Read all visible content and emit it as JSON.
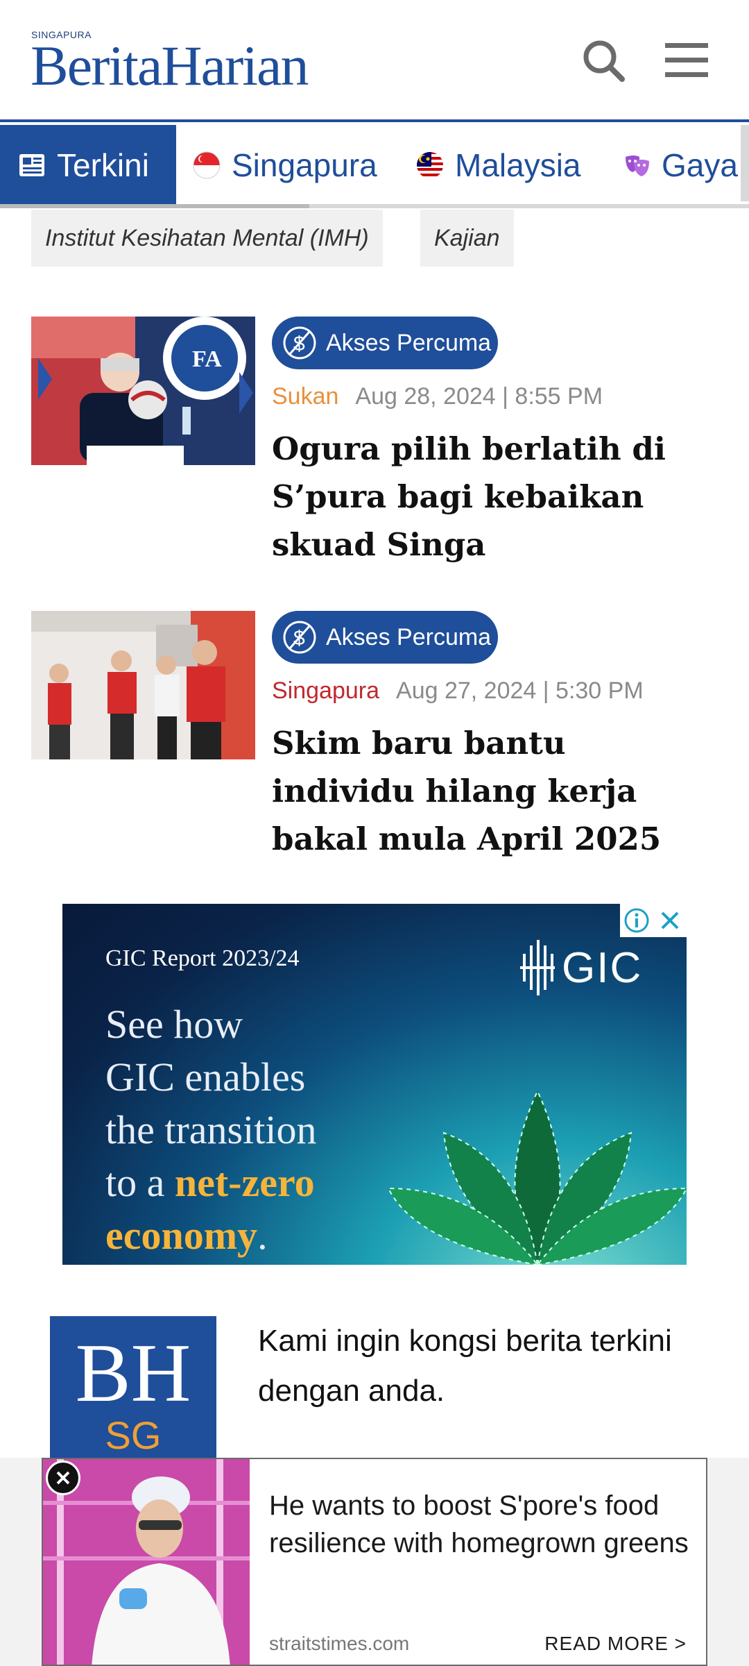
{
  "header": {
    "logo_small": "SINGAPURA",
    "logo_main": "BeritaHarian",
    "search_icon": "search-icon",
    "menu_icon": "hamburger-menu-icon"
  },
  "nav": {
    "tabs": [
      {
        "label": "Terkini",
        "icon": "newspaper-icon",
        "active": true
      },
      {
        "label": "Singapura",
        "icon": "singapore-flag-icon",
        "active": false
      },
      {
        "label": "Malaysia",
        "icon": "malaysia-flag-icon",
        "active": false
      },
      {
        "label": "Gaya",
        "icon": "theatre-masks-icon",
        "active": false
      }
    ]
  },
  "tags": [
    "Institut Kesihatan Mental (IMH)",
    "Kajian"
  ],
  "articles": [
    {
      "badge": "Akses Percuma",
      "category": "Sukan",
      "category_color": "#e8913a",
      "date": "Aug 28, 2024 | 8:55 PM",
      "headline": "Ogura pilih berlatih di S’pura bagi kebaikan skuad Singa"
    },
    {
      "badge": "Akses Percuma",
      "category": "Singapura",
      "category_color": "#c0282d",
      "date": "Aug 27, 2024 | 5:30 PM",
      "headline": "Skim baru bantu individu hilang kerja bakal mula April 2025"
    }
  ],
  "ad": {
    "report": "GIC Report 2023/24",
    "brand": "GIC",
    "lines": [
      "See how",
      "GIC enables",
      "the transition"
    ],
    "line4_prefix": "to a ",
    "line4_highlight": "net-zero",
    "line5_highlight": "economy",
    "line5_suffix": "."
  },
  "newsletter": {
    "logo_top": "BH",
    "logo_bottom": "SG",
    "text": "Kami ingin kongsi berita terkini dengan anda."
  },
  "bottom_ad": {
    "title": "He wants to boost S'pore's food resilience with homegrown greens",
    "source": "straitstimes.com",
    "read_more": "READ MORE >"
  },
  "colors": {
    "brand_blue": "#1f4e9a",
    "accent_orange": "#e8913a",
    "accent_red": "#c0282d"
  }
}
